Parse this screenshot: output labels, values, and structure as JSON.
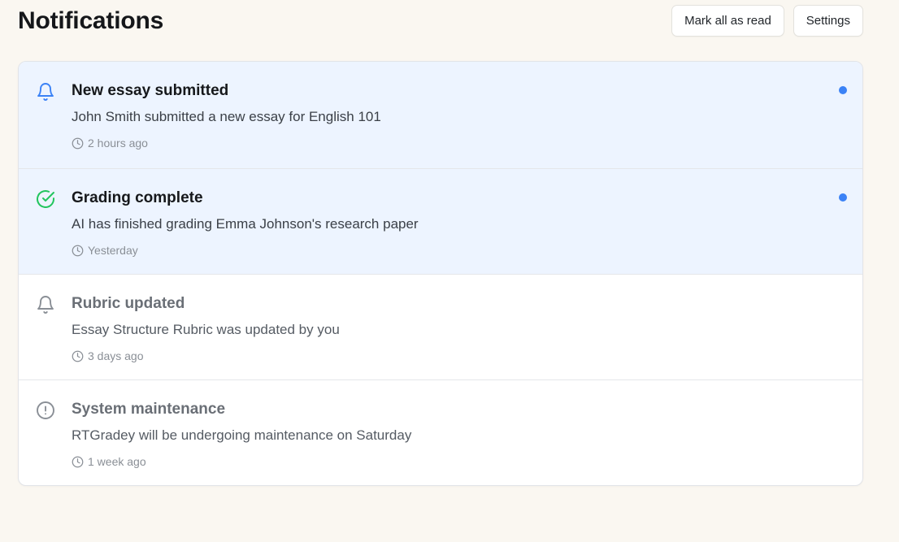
{
  "header": {
    "title": "Notifications",
    "mark_all_label": "Mark all as read",
    "settings_label": "Settings"
  },
  "colors": {
    "unread_background": "#edf4ff",
    "unread_dot": "#3b82f6",
    "bell_unread": "#3b82f6",
    "check": "#22c55e",
    "muted_icon": "#8a8f96"
  },
  "notifications": [
    {
      "icon": "bell-icon",
      "title": "New essay submitted",
      "message": "John Smith submitted a new essay for English 101",
      "time": "2 hours ago",
      "unread": true
    },
    {
      "icon": "check-circle-icon",
      "title": "Grading complete",
      "message": "AI has finished grading Emma Johnson's research paper",
      "time": "Yesterday",
      "unread": true
    },
    {
      "icon": "bell-icon",
      "title": "Rubric updated",
      "message": "Essay Structure Rubric was updated by you",
      "time": "3 days ago",
      "unread": false
    },
    {
      "icon": "alert-circle-icon",
      "title": "System maintenance",
      "message": "RTGradey will be undergoing maintenance on Saturday",
      "time": "1 week ago",
      "unread": false
    }
  ]
}
